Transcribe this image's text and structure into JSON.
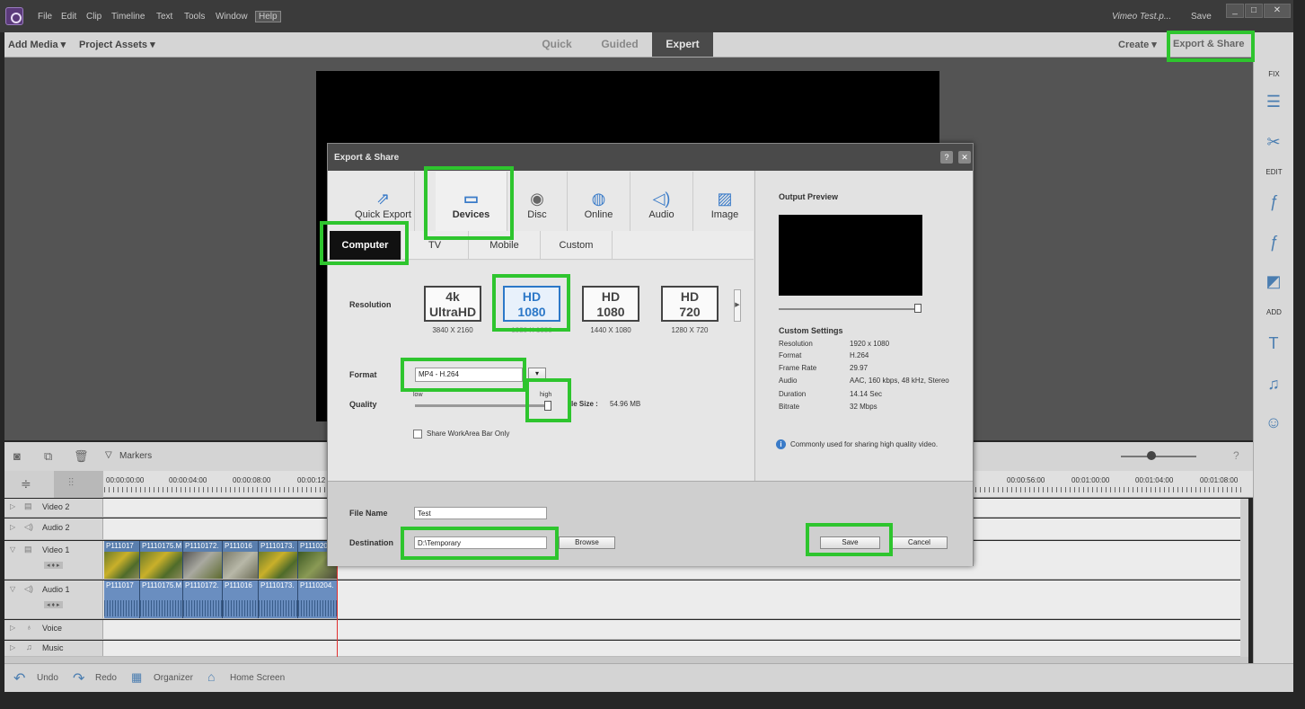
{
  "titlebar": {
    "menu": [
      "File",
      "Edit",
      "Clip",
      "Timeline",
      "Text",
      "Tools",
      "Window",
      "Help"
    ],
    "doc_title": "Vimeo Test.p...",
    "save": "Save",
    "win_min": "_",
    "win_max": "□",
    "win_close": "✕"
  },
  "toolbar": {
    "add_media": "Add Media ▾",
    "project_assets": "Project Assets ▾",
    "modes": [
      "Quick",
      "Guided",
      "Expert"
    ],
    "create": "Create ▾",
    "export_share": "Export & Share"
  },
  "right_panel": {
    "fix": "FIX",
    "edit": "EDIT",
    "add": "ADD"
  },
  "timeline": {
    "markers": "Markers",
    "ruler": [
      "00:00:00:00",
      "00:00:04:00",
      "00:00:08:00",
      "00:00:12",
      "00:00:56:00",
      "00:01:00:00",
      "00:01:04:00",
      "00:01:08:00"
    ],
    "tracks": [
      "Video 2",
      "Audio 2",
      "Video 1",
      "Audio 1",
      "Voice",
      "Music"
    ],
    "clips": [
      "P111017",
      "P1110175.M",
      "P1110172.",
      "P111016",
      "P1110173.",
      "P1110204."
    ]
  },
  "bottom": {
    "undo": "Undo",
    "redo": "Redo",
    "organizer": "Organizer",
    "home": "Home Screen"
  },
  "dialog": {
    "title": "Export & Share",
    "help": "?",
    "close": "✕",
    "categories": [
      "Quick Export",
      "Devices",
      "Disc",
      "Online",
      "Audio",
      "Image"
    ],
    "subtabs": [
      "Computer",
      "TV",
      "Mobile",
      "Custom"
    ],
    "resolution_label": "Resolution",
    "resolutions": [
      {
        "line1": "4k",
        "line2": "UltraHD",
        "dims": "3840 X 2160"
      },
      {
        "line1": "HD",
        "line2": "1080",
        "dims": "1920 X 1080"
      },
      {
        "line1": "HD",
        "line2": "1080",
        "dims": "1440 X 1080"
      },
      {
        "line1": "HD",
        "line2": "720",
        "dims": "1280 X 720"
      }
    ],
    "format_label": "Format",
    "format_value": "MP4 - H.264",
    "quality_label": "Quality",
    "quality_low": "low",
    "quality_high": "high",
    "quality_level": 1.0,
    "file_size_label": "le Size :",
    "file_size": "54.96 MB",
    "share_workarea": "Share WorkArea Bar Only",
    "output_preview": "Output Preview",
    "custom_settings_title": "Custom Settings",
    "settings": [
      {
        "k": "Resolution",
        "v": "1920 x 1080"
      },
      {
        "k": "Format",
        "v": "H.264"
      },
      {
        "k": "Frame Rate",
        "v": "29.97"
      },
      {
        "k": "Audio",
        "v": "AAC, 160 kbps, 48 kHz, Stereo"
      },
      {
        "k": "Duration",
        "v": "14.14 Sec"
      },
      {
        "k": "Bitrate",
        "v": "32 Mbps"
      }
    ],
    "info_note": "Commonly used for sharing high quality video.",
    "file_name_label": "File Name",
    "file_name": "Test",
    "destination_label": "Destination",
    "destination": "D:\\Temporary",
    "browse": "Browse",
    "save": "Save",
    "cancel": "Cancel"
  }
}
